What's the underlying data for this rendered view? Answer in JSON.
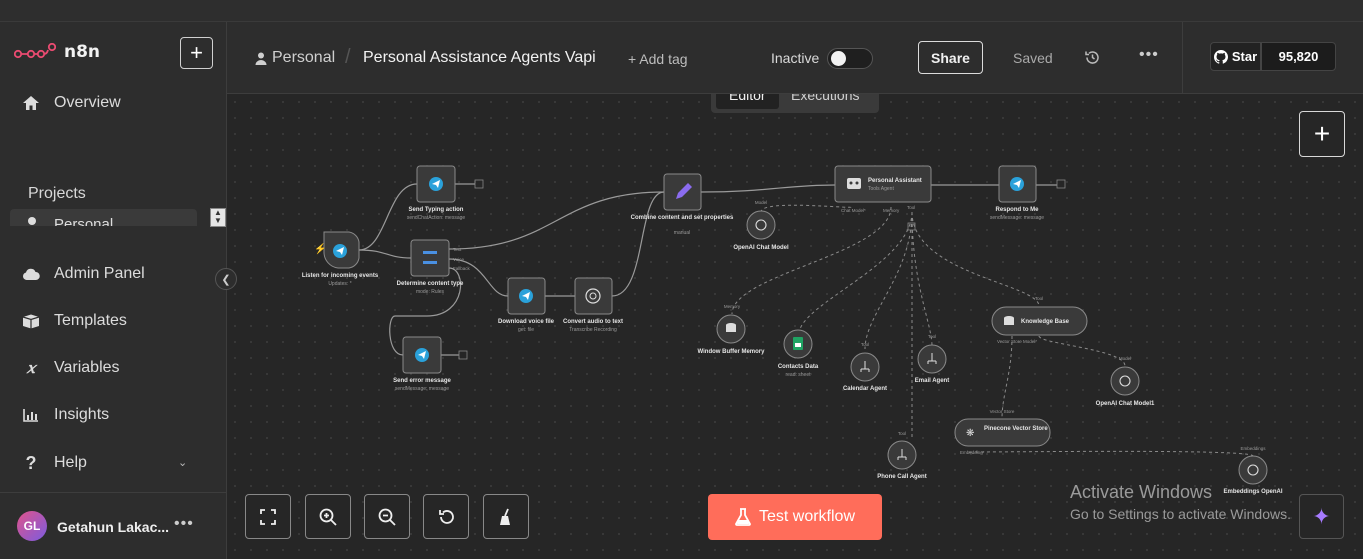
{
  "app": {
    "logo_text": "n8n"
  },
  "sidebar": {
    "nav": [
      {
        "label": "Overview",
        "icon": "home-icon"
      },
      {
        "label": "Admin Panel",
        "icon": "cloud-icon"
      },
      {
        "label": "Templates",
        "icon": "box-icon"
      },
      {
        "label": "Variables",
        "icon": "variable-icon"
      },
      {
        "label": "Insights",
        "icon": "chart-icon"
      },
      {
        "label": "Help",
        "icon": "question-icon"
      }
    ],
    "projects_label": "Projects",
    "project_item": "Personal",
    "user": {
      "initials": "GL",
      "name": "Getahun Lakac..."
    }
  },
  "header": {
    "breadcrumb": "Personal",
    "workflow_name": "Personal Assistance Agents Vapi",
    "add_tag": "+ Add tag",
    "status": "Inactive",
    "share": "Share",
    "saved": "Saved",
    "github_star": "Star",
    "github_count": "95,820"
  },
  "tabs": {
    "editor": "Editor",
    "executions": "Executions"
  },
  "canvas": {
    "test_button": "Test workflow",
    "activate_title": "Activate Windows",
    "activate_sub": "Go to Settings to activate Windows.",
    "nodes": {
      "trigger": {
        "name": "Listen for incoming events",
        "sub": "Updates: *"
      },
      "typing": {
        "name": "Send Typing action",
        "sub": "sendChatAction: message"
      },
      "switch": {
        "name": "Determine content type",
        "sub": "mode: Rules"
      },
      "error": {
        "name": "Send error message",
        "sub": "sendMessage: message"
      },
      "download": {
        "name": "Download voice file",
        "sub": "get: file"
      },
      "convert": {
        "name": "Convert audio to text",
        "sub": "Transcribe Recording"
      },
      "combine": {
        "name": "Combine content and set properties",
        "sub": "manual"
      },
      "assistant": {
        "name": "Personal Assistant",
        "sub": "Tools Agent"
      },
      "respond": {
        "name": "Respond to Me",
        "sub": "sendMessage: message"
      },
      "openai_chat": {
        "name": "OpenAI Chat Model"
      },
      "memory": {
        "name": "Window Buffer Memory"
      },
      "contacts": {
        "name": "Contacts Data",
        "sub": "read: sheet"
      },
      "calendar": {
        "name": "Calendar Agent"
      },
      "email": {
        "name": "Email Agent"
      },
      "knowledge": {
        "name": "Knowledge Base"
      },
      "openai_chat1": {
        "name": "OpenAI Chat Model1"
      },
      "pinecone": {
        "name": "Pinecone Vector Store"
      },
      "phone": {
        "name": "Phone Call Agent"
      },
      "embeddings": {
        "name": "Embeddings OpenAI"
      }
    },
    "ports": {
      "text": "Text",
      "voice": "Voice",
      "fallback": "Fallback",
      "chat_model": "Chat Model*",
      "memory": "Memory",
      "tool": "Tool",
      "model": "Model",
      "vector_store_model": "Vector Store Model*",
      "vector_store": "Vector Store",
      "embedding": "Embedding*",
      "embeddings": "Embeddings"
    }
  },
  "colors": {
    "accent": "#ff6d5a",
    "telegram": "#2aa1da",
    "sheets": "#1fa463",
    "edit": "#8b6cef"
  }
}
